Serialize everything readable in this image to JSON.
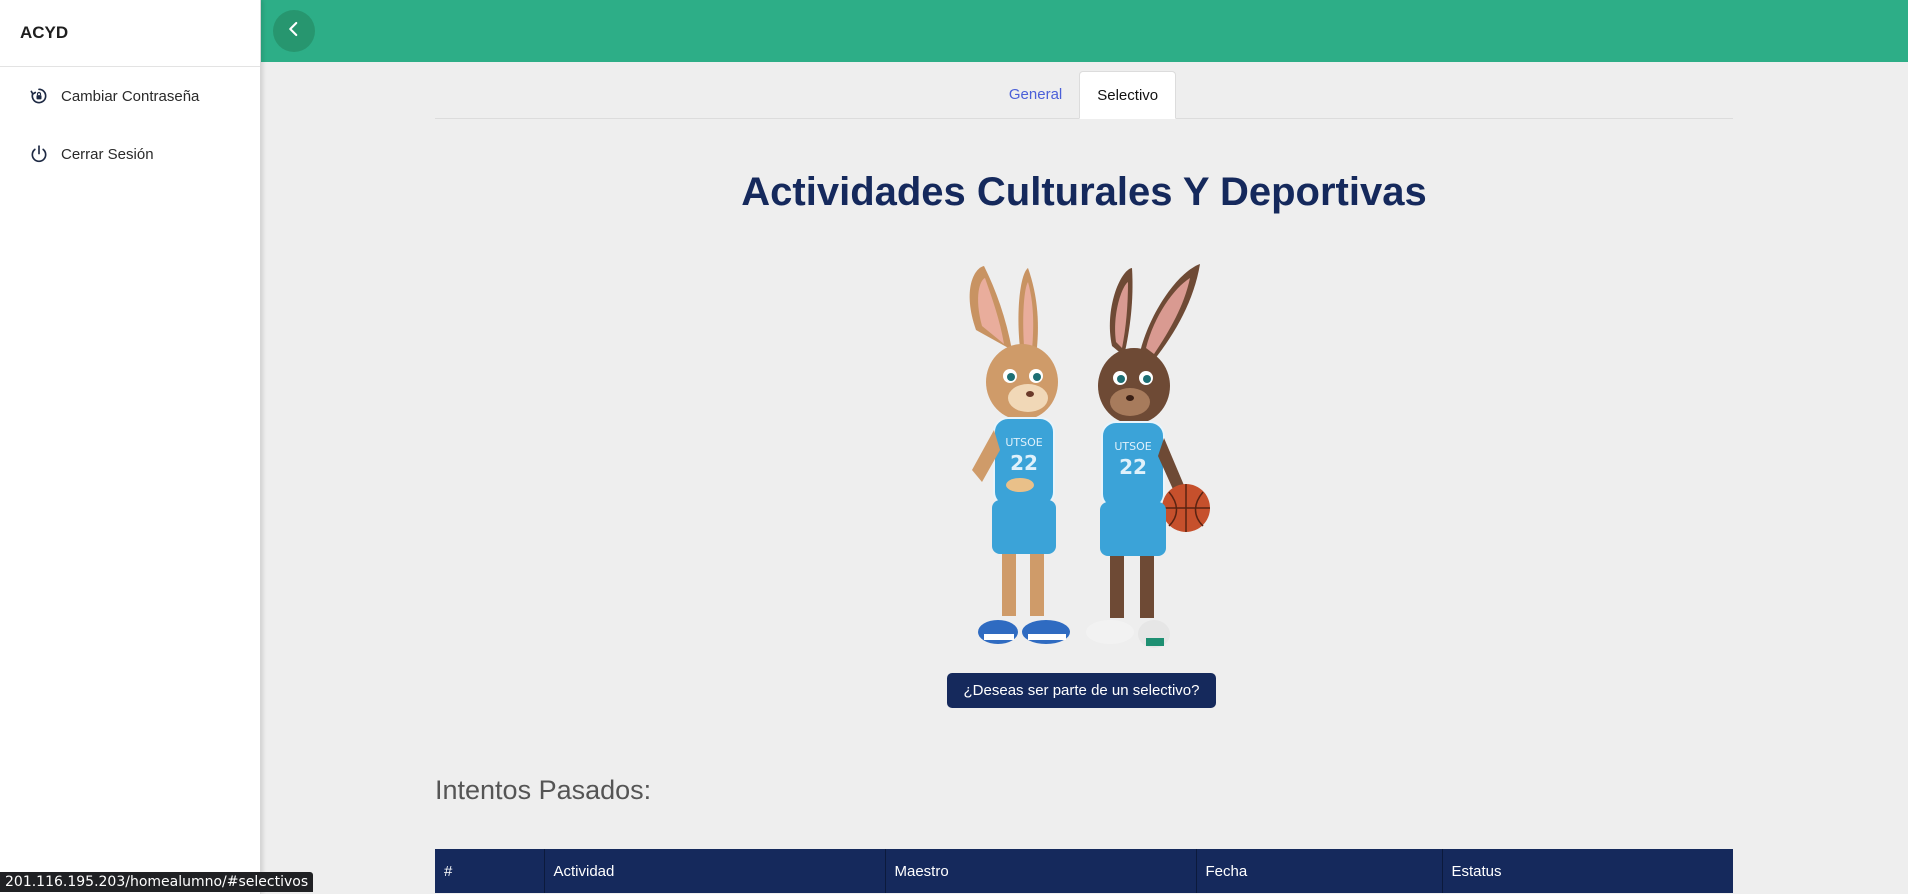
{
  "sidebar": {
    "brand": "ACYD",
    "items": [
      {
        "label": "Cambiar Contraseña",
        "icon": "lock-reset-icon"
      },
      {
        "label": "Cerrar Sesión",
        "icon": "power-icon"
      }
    ]
  },
  "topbar": {
    "back_icon": "chevron-left-icon",
    "color": "#2dae87"
  },
  "tabs": [
    {
      "label": "General",
      "active": false
    },
    {
      "label": "Selectivo",
      "active": true
    }
  ],
  "main": {
    "title": "Actividades Culturales Y Deportivas",
    "cta_label": "¿Deseas ser parte de un selectivo?",
    "past_attempts_title": "Intentos Pasados:",
    "mascot_jersey_text": "UTSOE",
    "mascot_jersey_number": "22"
  },
  "table": {
    "headers": [
      "#",
      "Actividad",
      "Maestro",
      "Fecha",
      "Estatus"
    ]
  },
  "status_bar": {
    "url": "201.116.195.203/homealumno/#selectivos"
  },
  "colors": {
    "primary_dark": "#15295c",
    "accent_green": "#2dae87",
    "link_blue": "#4a5fd8"
  }
}
